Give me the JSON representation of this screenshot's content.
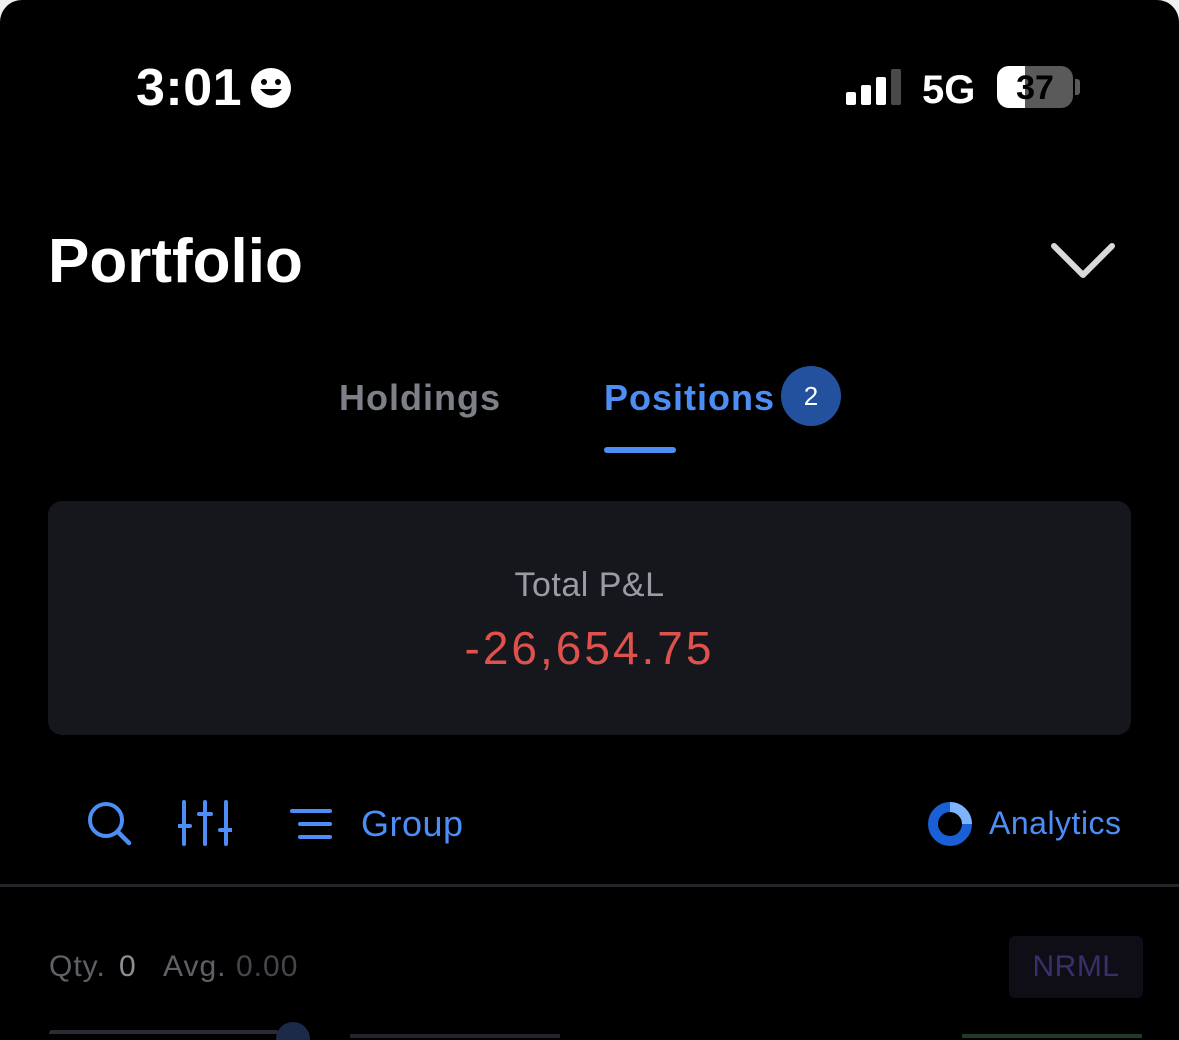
{
  "status_bar": {
    "time": "3:01",
    "network": "5G",
    "battery_level": "37",
    "battery_fraction": 0.37,
    "signal_bars_active": 3,
    "signal_bars_total": 4,
    "focus_icon": "smiley-face-icon"
  },
  "header": {
    "title": "Portfolio",
    "dropdown_icon": "chevron-down-icon"
  },
  "tabs": [
    {
      "label": "Holdings",
      "active": false
    },
    {
      "label": "Positions",
      "active": true,
      "badge": "2"
    }
  ],
  "pnl_card": {
    "label": "Total P&L",
    "value": "-26,654.75"
  },
  "toolbar": {
    "search_icon": "search-icon",
    "filter_icon": "sliders-icon",
    "group_icon": "list-icon",
    "group_label": "Group",
    "analytics_icon": "donut-chart-icon",
    "analytics_label": "Analytics"
  },
  "positions": [
    {
      "qty_label": "Qty.",
      "qty_value": "0",
      "avg_label": "Avg.",
      "avg_value": "0.00",
      "product": "NRML"
    }
  ],
  "colors": {
    "background": "#000000",
    "accent": "#4c8df6",
    "badge": "#24519e",
    "loss": "#df514c",
    "card": "#15171c",
    "muted": "#7d8087"
  }
}
